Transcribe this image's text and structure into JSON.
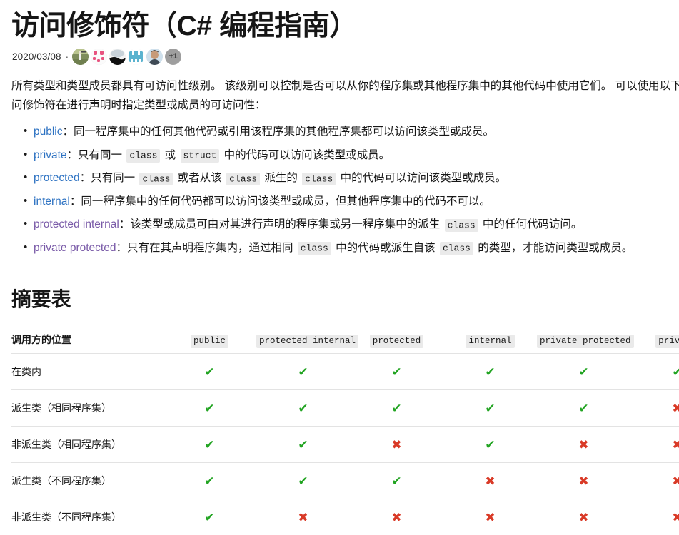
{
  "article": {
    "title": "访问修饰符（C# 编程指南）",
    "byline": {
      "date": "2020/03/08",
      "separator": "·",
      "more_count": "+1",
      "avatars": [
        {
          "name": "avatar-golfer"
        },
        {
          "name": "avatar-pink-pattern"
        },
        {
          "name": "avatar-landscape"
        },
        {
          "name": "avatar-blue-pixel"
        },
        {
          "name": "avatar-portrait"
        }
      ]
    },
    "intro": "所有类型和类型成员都具有可访问性级别。 该级别可以控制是否可以从你的程序集或其他程序集中的其他代码中使用它们。 可以使用以下访问修饰符在进行声明时指定类型或成员的可访问性：",
    "modifiers": [
      {
        "term": "public",
        "link_state": "unvisited",
        "colon": "：",
        "parts": [
          {
            "type": "text",
            "value": "同一程序集中的任何其他代码或引用该程序集的其他程序集都可以访问该类型或成员。"
          }
        ]
      },
      {
        "term": "private",
        "link_state": "unvisited",
        "colon": "：",
        "parts": [
          {
            "type": "text",
            "value": "只有同一 "
          },
          {
            "type": "code",
            "value": "class"
          },
          {
            "type": "text",
            "value": " 或 "
          },
          {
            "type": "code",
            "value": "struct"
          },
          {
            "type": "text",
            "value": " 中的代码可以访问该类型或成员。"
          }
        ]
      },
      {
        "term": "protected",
        "link_state": "unvisited",
        "colon": "：",
        "parts": [
          {
            "type": "text",
            "value": "只有同一 "
          },
          {
            "type": "code",
            "value": "class"
          },
          {
            "type": "text",
            "value": " 或者从该 "
          },
          {
            "type": "code",
            "value": "class"
          },
          {
            "type": "text",
            "value": " 派生的 "
          },
          {
            "type": "code",
            "value": "class"
          },
          {
            "type": "text",
            "value": " 中的代码可以访问该类型或成员。"
          }
        ]
      },
      {
        "term": "internal",
        "link_state": "unvisited",
        "colon": "：",
        "parts": [
          {
            "type": "text",
            "value": "同一程序集中的任何代码都可以访问该类型或成员，但其他程序集中的代码不可以。"
          }
        ]
      },
      {
        "term": "protected internal",
        "link_state": "visited",
        "colon": "：",
        "parts": [
          {
            "type": "text",
            "value": "该类型或成员可由对其进行声明的程序集或另一程序集中的派生 "
          },
          {
            "type": "code",
            "value": "class"
          },
          {
            "type": "text",
            "value": " 中的任何代码访问。"
          }
        ]
      },
      {
        "term": "private protected",
        "link_state": "visited",
        "colon": "：",
        "parts": [
          {
            "type": "text",
            "value": "只有在其声明程序集内，通过相同 "
          },
          {
            "type": "code",
            "value": "class"
          },
          {
            "type": "text",
            "value": " 中的代码或派生自该 "
          },
          {
            "type": "code",
            "value": "class"
          },
          {
            "type": "text",
            "value": " 的类型，才能访问类型或成员。"
          }
        ]
      }
    ],
    "section_heading": "摘要表"
  },
  "colors": {
    "link": "#2d72c2",
    "link_visited": "#7a5ba8",
    "yes": "#22a422",
    "no": "#d93a27",
    "code_bg": "#eaeaea",
    "rule": "#e3e3e3",
    "text": "#171717"
  },
  "icons": {
    "yes": "check-icon",
    "no": "cross-icon"
  },
  "table": {
    "first_column_header": "调用方的位置",
    "column_headers": [
      "public",
      "protected internal",
      "protected",
      "internal",
      "private protected",
      "private"
    ],
    "rows": [
      {
        "location": "在类内",
        "values": [
          "yes",
          "yes",
          "yes",
          "yes",
          "yes",
          "yes"
        ]
      },
      {
        "location": "派生类（相同程序集）",
        "values": [
          "yes",
          "yes",
          "yes",
          "yes",
          "yes",
          "no"
        ]
      },
      {
        "location": "非派生类（相同程序集）",
        "values": [
          "yes",
          "yes",
          "no",
          "yes",
          "no",
          "no"
        ]
      },
      {
        "location": "派生类（不同程序集）",
        "values": [
          "yes",
          "yes",
          "yes",
          "no",
          "no",
          "no"
        ]
      },
      {
        "location": "非派生类（不同程序集）",
        "values": [
          "yes",
          "no",
          "no",
          "no",
          "no",
          "no"
        ]
      }
    ]
  }
}
